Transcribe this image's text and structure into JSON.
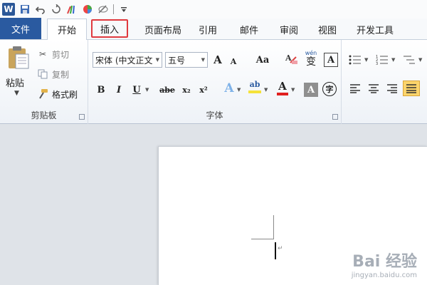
{
  "quick_access": {
    "app_icon_label": "W",
    "items": [
      "save-icon",
      "undo-icon",
      "redo-icon",
      "paint-icon",
      "color-icon",
      "eraser-icon",
      "customize-icon"
    ]
  },
  "tabs": {
    "file": "文件",
    "items": [
      {
        "label": "开始",
        "state": "active"
      },
      {
        "label": "插入",
        "state": "highlighted"
      },
      {
        "label": "页面布局",
        "state": "normal"
      },
      {
        "label": "引用",
        "state": "normal"
      },
      {
        "label": "邮件",
        "state": "normal"
      },
      {
        "label": "审阅",
        "state": "normal"
      },
      {
        "label": "视图",
        "state": "normal"
      },
      {
        "label": "开发工具",
        "state": "normal"
      }
    ]
  },
  "clipboard": {
    "paste": "粘贴",
    "cut": "剪切",
    "copy": "复制",
    "format_painter": "格式刷",
    "group_label": "剪贴板"
  },
  "font": {
    "font_name": "宋体 (中文正文",
    "font_size": "五号",
    "grow": "A",
    "shrink": "A",
    "change_case": "Aa",
    "clear_format_label": "A",
    "phonetic_text": "wén",
    "phonetic_char": "变",
    "char_border": "A",
    "bold": "B",
    "italic": "I",
    "underline": "U",
    "strike": "abe",
    "subscript": "x₂",
    "superscript": "x²",
    "text_effect": "A",
    "highlight": "ab",
    "font_color": "A",
    "char_shading": "A",
    "enclose_char": "字",
    "group_label": "字体"
  },
  "colors": {
    "accent": "#2a5aa0",
    "highlight_tab_border": "#e0393e",
    "font_color_bar": "#e0201f",
    "highlight_bar": "#f5e23a"
  },
  "watermark": {
    "brand": "Bai 经验",
    "url": "jingyan.baidu.com"
  }
}
